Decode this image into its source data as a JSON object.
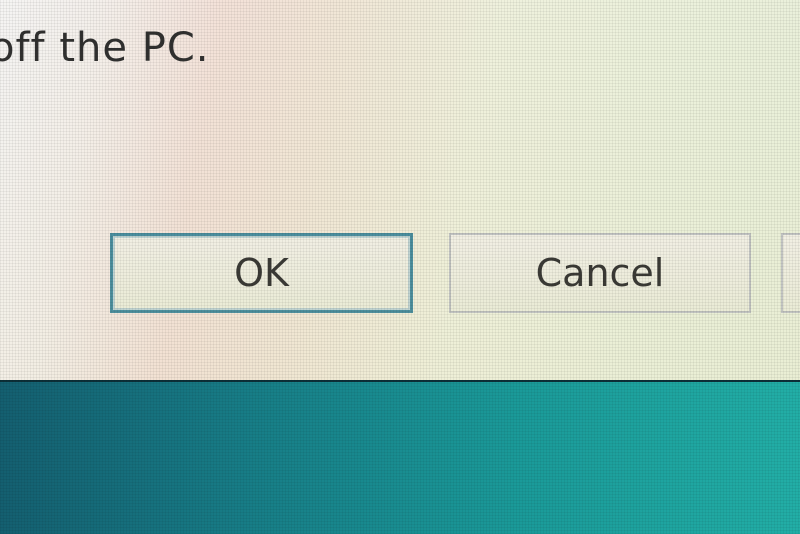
{
  "dialog": {
    "message": "off the PC.",
    "buttons": {
      "ok_label": "OK",
      "cancel_label": "Cancel"
    }
  },
  "colors": {
    "ok_focus_border": "#2f7e95",
    "taskbar": "#1a9a99"
  }
}
